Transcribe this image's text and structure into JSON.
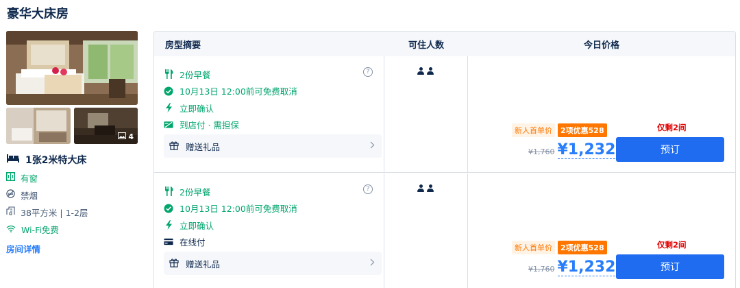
{
  "room_title": "豪华大床房",
  "gallery": {
    "photo_count": "4"
  },
  "room_info": {
    "bed": "1张2米特大床",
    "window": "有窗",
    "smoking": "禁烟",
    "area_floor": "38平方米 | 1-2层",
    "wifi": "Wi-Fi免费",
    "detail_link": "房间详情"
  },
  "table": {
    "headers": {
      "summary": "房型摘要",
      "occupancy": "可住人数",
      "price": "今日价格"
    },
    "rows": [
      {
        "breakfast": "2份早餐",
        "cancel": "10月13日 12:00前可免费取消",
        "confirm": "立即确认",
        "payment": "到店付 · 需担保",
        "gift": "赠送礼品",
        "help": "?",
        "promo_new": "新人首单价",
        "promo_badge": "2项优惠528",
        "old_price": "¥1,760",
        "price": "¥1,232",
        "remaining": "仅剩2间",
        "book": "预订"
      },
      {
        "breakfast": "2份早餐",
        "cancel": "10月13日 12:00前可免费取消",
        "confirm": "立即确认",
        "payment": "在线付",
        "gift": "赠送礼品",
        "help": "?",
        "promo_new": "新人首单价",
        "promo_badge": "2项优惠528",
        "old_price": "¥1,760",
        "price": "¥1,232",
        "remaining": "仅剩2间",
        "book": "预订"
      }
    ]
  },
  "colors": {
    "accent": "#287dfa",
    "green": "#00a66c",
    "orange": "#ff7700",
    "red": "#e20000",
    "button": "#1f6cf0"
  }
}
